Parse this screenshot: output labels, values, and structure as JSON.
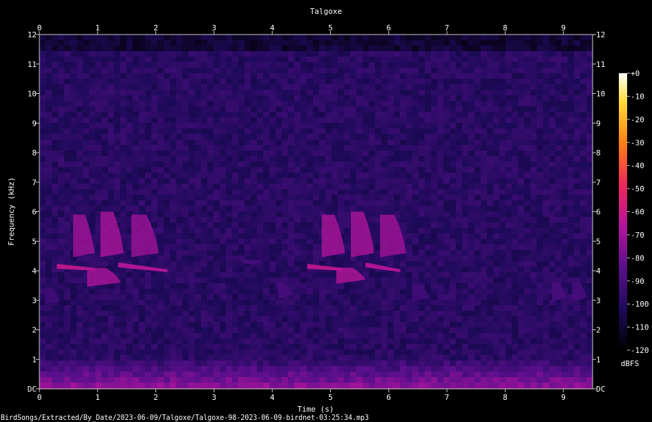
{
  "chart_data": {
    "type": "heatmap",
    "title": "Talgoxe",
    "xlabel": "Time (s)",
    "ylabel": "Frequency (kHz)",
    "xlim": [
      0,
      9.5
    ],
    "ylim": [
      0,
      12
    ],
    "x_ticks": [
      "0",
      "1",
      "2",
      "3",
      "4",
      "5",
      "6",
      "7",
      "8",
      "9"
    ],
    "y_ticks": [
      "DC",
      "1",
      "2",
      "3",
      "4",
      "5",
      "6",
      "7",
      "8",
      "9",
      "10",
      "11",
      "12"
    ],
    "colorbar": {
      "label": "dBFS",
      "ticks": [
        "+0",
        "-10",
        "-20",
        "-30",
        "-40",
        "-50",
        "-60",
        "-70",
        "-80",
        "-90",
        "-100",
        "-110",
        "-120"
      ],
      "range": [
        -120,
        0
      ],
      "colors": [
        "#000000",
        "#1e0a5a",
        "#5a0f8c",
        "#b4149b",
        "#f0285a",
        "#ff8214",
        "#ffdc3c",
        "#ffffff"
      ]
    },
    "background_level_dbfs": -100,
    "noise_floor_band_khz": [
      0,
      1.2
    ],
    "syllables": [
      {
        "t": 0.3,
        "t_end": 0.95,
        "f": 4.15,
        "f_end": 4.05,
        "level": -65
      },
      {
        "t": 0.58,
        "t_end": 0.95,
        "f": 5.9,
        "f_end": 4.6,
        "level": -72
      },
      {
        "t": 0.82,
        "t_end": 1.4,
        "f": 4.1,
        "f_end": 3.6,
        "level": -70
      },
      {
        "t": 1.05,
        "t_end": 1.45,
        "f": 6.0,
        "f_end": 4.6,
        "level": -70
      },
      {
        "t": 1.35,
        "t_end": 2.2,
        "f": 4.2,
        "f_end": 4.0,
        "level": -68
      },
      {
        "t": 1.58,
        "t_end": 2.05,
        "f": 5.9,
        "f_end": 4.6,
        "level": -73
      },
      {
        "t": 4.6,
        "t_end": 5.2,
        "f": 4.15,
        "f_end": 4.05,
        "level": -65
      },
      {
        "t": 4.85,
        "t_end": 5.25,
        "f": 5.9,
        "f_end": 4.6,
        "level": -70
      },
      {
        "t": 5.1,
        "t_end": 5.6,
        "f": 4.1,
        "f_end": 3.7,
        "level": -68
      },
      {
        "t": 5.35,
        "t_end": 5.75,
        "f": 6.0,
        "f_end": 4.6,
        "level": -70
      },
      {
        "t": 5.6,
        "t_end": 6.2,
        "f": 4.2,
        "f_end": 4.0,
        "level": -68
      },
      {
        "t": 5.85,
        "t_end": 6.3,
        "f": 5.9,
        "f_end": 4.6,
        "level": -72
      },
      {
        "t": 3.5,
        "t_end": 3.8,
        "f": 4.3,
        "f_end": 4.3,
        "level": -92
      },
      {
        "t": 4.1,
        "t_end": 4.35,
        "f": 3.6,
        "f_end": 3.2,
        "level": -90
      },
      {
        "t": 6.4,
        "t_end": 6.7,
        "f": 3.5,
        "f_end": 3.1,
        "level": -92
      },
      {
        "t": 8.8,
        "t_end": 9.05,
        "f": 3.6,
        "f_end": 3.1,
        "level": -90
      },
      {
        "t": 9.15,
        "t_end": 9.4,
        "f": 3.6,
        "f_end": 3.1,
        "level": -90
      },
      {
        "t": 0.1,
        "t_end": 0.35,
        "f": 3.4,
        "f_end": 3.0,
        "level": -92
      }
    ]
  },
  "footer": {
    "file_path": "BirdSongs/Extracted/By_Date/2023-06-09/Talgoxe/Talgoxe-98-2023-06-09-birdnet-03:25:34.mp3"
  }
}
